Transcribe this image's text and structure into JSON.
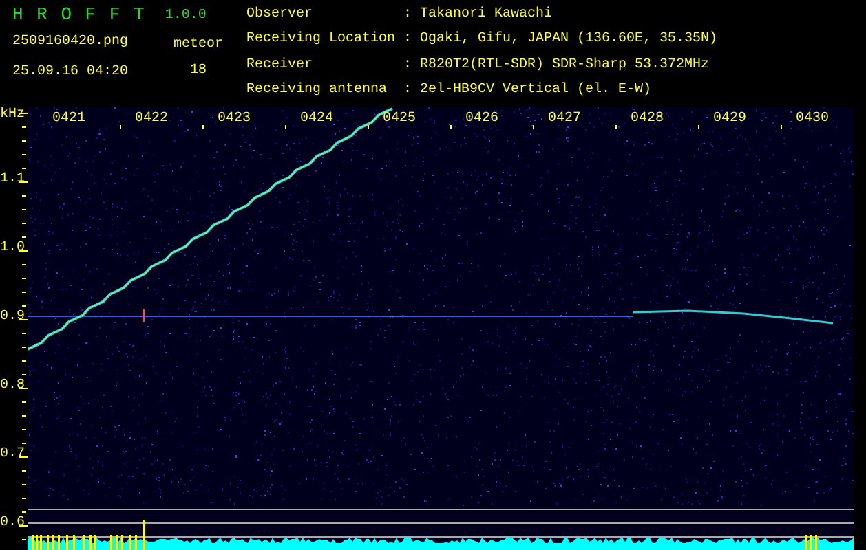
{
  "app": {
    "name": "H R O F F T",
    "version": "1.0.0"
  },
  "file": "2509160420.png",
  "datetime": "25.09.16 04:20",
  "meteor": {
    "label": "meteor",
    "count": "18"
  },
  "info": [
    {
      "label": "Observer",
      "value": ": Takanori Kawachi"
    },
    {
      "label": "Receiving Location",
      "value": ": Ogaki, Gifu, JAPAN (136.60E, 35.35N)"
    },
    {
      "label": "Receiver",
      "value": ": R820T2(RTL-SDR) SDR-Sharp 53.372MHz"
    },
    {
      "label": "Receiving antenna",
      "value": ": 2el-HB9CV Vertical (el. E-W)"
    }
  ],
  "y_axis": {
    "unit": "kHz",
    "labels": [
      "1.1",
      "1.0",
      "0.9",
      "0.8",
      "0.7",
      "0.6"
    ]
  },
  "x_axis": {
    "labels": [
      "0421",
      "0422",
      "0423",
      "0424",
      "0425",
      "0426",
      "0427",
      "0428",
      "0429",
      "0430"
    ]
  }
}
